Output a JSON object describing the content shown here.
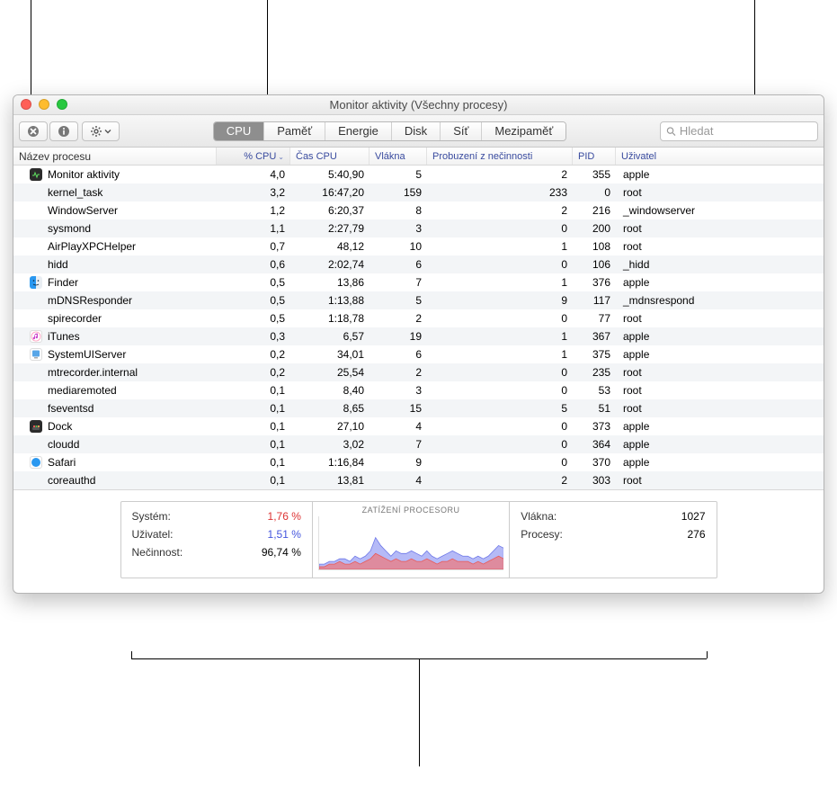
{
  "window": {
    "title": "Monitor aktivity (Všechny procesy)"
  },
  "toolbar": {
    "search_placeholder": "Hledat"
  },
  "tabs": [
    {
      "label": "CPU",
      "active": true
    },
    {
      "label": "Paměť",
      "active": false
    },
    {
      "label": "Energie",
      "active": false
    },
    {
      "label": "Disk",
      "active": false
    },
    {
      "label": "Síť",
      "active": false
    },
    {
      "label": "Mezipaměť",
      "active": false
    }
  ],
  "columns": {
    "name": "Název procesu",
    "cpu": "% CPU",
    "time": "Čas CPU",
    "threads": "Vlákna",
    "wakeups": "Probuzení z nečinnosti",
    "pid": "PID",
    "user": "Uživatel"
  },
  "sort": {
    "column": "cpu",
    "direction": "desc"
  },
  "rows": [
    {
      "icon": "activity",
      "name": "Monitor aktivity",
      "cpu": "4,0",
      "time": "5:40,90",
      "threads": "5",
      "wakeups": "2",
      "pid": "355",
      "user": "apple"
    },
    {
      "icon": "",
      "name": "kernel_task",
      "cpu": "3,2",
      "time": "16:47,20",
      "threads": "159",
      "wakeups": "233",
      "pid": "0",
      "user": "root"
    },
    {
      "icon": "",
      "name": "WindowServer",
      "cpu": "1,2",
      "time": "6:20,37",
      "threads": "8",
      "wakeups": "2",
      "pid": "216",
      "user": "_windowserver"
    },
    {
      "icon": "",
      "name": "sysmond",
      "cpu": "1,1",
      "time": "2:27,79",
      "threads": "3",
      "wakeups": "0",
      "pid": "200",
      "user": "root"
    },
    {
      "icon": "",
      "name": "AirPlayXPCHelper",
      "cpu": "0,7",
      "time": "48,12",
      "threads": "10",
      "wakeups": "1",
      "pid": "108",
      "user": "root"
    },
    {
      "icon": "",
      "name": "hidd",
      "cpu": "0,6",
      "time": "2:02,74",
      "threads": "6",
      "wakeups": "0",
      "pid": "106",
      "user": "_hidd"
    },
    {
      "icon": "finder",
      "name": "Finder",
      "cpu": "0,5",
      "time": "13,86",
      "threads": "7",
      "wakeups": "1",
      "pid": "376",
      "user": "apple"
    },
    {
      "icon": "",
      "name": "mDNSResponder",
      "cpu": "0,5",
      "time": "1:13,88",
      "threads": "5",
      "wakeups": "9",
      "pid": "117",
      "user": "_mdnsrespond"
    },
    {
      "icon": "",
      "name": "spirecorder",
      "cpu": "0,5",
      "time": "1:18,78",
      "threads": "2",
      "wakeups": "0",
      "pid": "77",
      "user": "root"
    },
    {
      "icon": "itunes",
      "name": "iTunes",
      "cpu": "0,3",
      "time": "6,57",
      "threads": "19",
      "wakeups": "1",
      "pid": "367",
      "user": "apple"
    },
    {
      "icon": "system",
      "name": "SystemUIServer",
      "cpu": "0,2",
      "time": "34,01",
      "threads": "6",
      "wakeups": "1",
      "pid": "375",
      "user": "apple"
    },
    {
      "icon": "",
      "name": "mtrecorder.internal",
      "cpu": "0,2",
      "time": "25,54",
      "threads": "2",
      "wakeups": "0",
      "pid": "235",
      "user": "root"
    },
    {
      "icon": "",
      "name": "mediaremoted",
      "cpu": "0,1",
      "time": "8,40",
      "threads": "3",
      "wakeups": "0",
      "pid": "53",
      "user": "root"
    },
    {
      "icon": "",
      "name": "fseventsd",
      "cpu": "0,1",
      "time": "8,65",
      "threads": "15",
      "wakeups": "5",
      "pid": "51",
      "user": "root"
    },
    {
      "icon": "dock",
      "name": "Dock",
      "cpu": "0,1",
      "time": "27,10",
      "threads": "4",
      "wakeups": "0",
      "pid": "373",
      "user": "apple"
    },
    {
      "icon": "",
      "name": "cloudd",
      "cpu": "0,1",
      "time": "3,02",
      "threads": "7",
      "wakeups": "0",
      "pid": "364",
      "user": "apple"
    },
    {
      "icon": "safari",
      "name": "Safari",
      "cpu": "0,1",
      "time": "1:16,84",
      "threads": "9",
      "wakeups": "0",
      "pid": "370",
      "user": "apple"
    },
    {
      "icon": "",
      "name": "coreauthd",
      "cpu": "0,1",
      "time": "13,81",
      "threads": "4",
      "wakeups": "2",
      "pid": "303",
      "user": "root"
    }
  ],
  "footer": {
    "left": {
      "system_label": "Systém:",
      "system_value": "1,76 %",
      "user_label": "Uživatel:",
      "user_value": "1,51 %",
      "idle_label": "Nečinnost:",
      "idle_value": "96,74 %"
    },
    "mid": {
      "title": "ZATÍŽENÍ PROCESORU"
    },
    "right": {
      "threads_label": "Vlákna:",
      "threads_value": "1027",
      "processes_label": "Procesy:",
      "processes_value": "276"
    }
  },
  "chart_data": {
    "type": "area",
    "title": "ZATÍŽENÍ PROCESORU",
    "ylim": [
      0,
      20
    ],
    "xlabel": "",
    "ylabel": "",
    "series": [
      {
        "name": "Systém",
        "color": "#f27a7a",
        "values": [
          1,
          1,
          2,
          2,
          3,
          2,
          2,
          3,
          2,
          3,
          4,
          6,
          5,
          4,
          3,
          4,
          3,
          3,
          4,
          3,
          3,
          4,
          3,
          2,
          3,
          3,
          4,
          3,
          3,
          3,
          2,
          3,
          2,
          3,
          4,
          5,
          4
        ]
      },
      {
        "name": "Uživatel",
        "color": "#8a8ef4",
        "values": [
          2,
          2,
          3,
          3,
          4,
          4,
          3,
          5,
          4,
          5,
          7,
          12,
          9,
          7,
          5,
          7,
          6,
          6,
          7,
          6,
          5,
          7,
          5,
          4,
          5,
          6,
          7,
          6,
          5,
          5,
          4,
          5,
          4,
          5,
          7,
          9,
          8
        ]
      }
    ]
  }
}
